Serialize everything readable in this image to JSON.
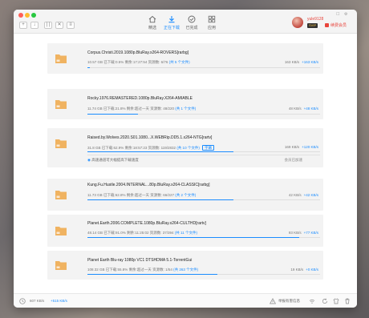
{
  "toolbar": {
    "buttons": [
      "+",
      "↓",
      "| |",
      "✕",
      "≡"
    ]
  },
  "tabs": [
    {
      "label": "精选",
      "icon": "home-icon"
    },
    {
      "label": "正在下载",
      "icon": "download-icon"
    },
    {
      "label": "已完成",
      "icon": "check-circle-icon"
    },
    {
      "label": "应用",
      "icon": "apps-icon"
    }
  ],
  "account": {
    "username": "yule9128",
    "vip_badge": "SVIP",
    "upgrade_label": "续费会员"
  },
  "downloads": [
    {
      "name": "Corpus.Christi.2019.1080p.BluRay.x264-ROVERS[rarbg]",
      "size": "10.57 GB",
      "downloaded": "已下载:0.5%",
      "remaining": "剩余:17:27:54",
      "resources": "资源数: 6/76",
      "files": "(共 5 个文件)",
      "down_speed": "163 KB/s",
      "up_speed": "+163 KB/s",
      "progress": 0.005
    },
    {
      "name": "Rocky.1976.REMASTERED.1080p.BluRay.X264-AMIABLE",
      "size": "11.74 GB",
      "downloaded": "已下载:21.8%",
      "remaining": "剩余:超过一天",
      "resources": "资源数: 48/220",
      "files": "(共 1 个文件)",
      "down_speed": "48 KB/s",
      "up_speed": "+48 KB/s",
      "progress": 0.218
    },
    {
      "name": "Raised.by.Wolves.2020.S01.1080...X.WEBRip.DD5.1.x264-NTG[rartv]",
      "size": "31.8 GB",
      "downloaded": "已下载:62.9%",
      "remaining": "剩余:18:57:23",
      "resources": "资源数: 119/2832",
      "files": "(共 10 个文件)",
      "tag": "字幕",
      "down_speed": "169 KB/s",
      "up_speed": "+120 KB/s",
      "progress": 0.629,
      "hint": "高速通道可大幅提高下载速度",
      "hint_right": "会员已加速"
    },
    {
      "name": "Kung.Fu.Hustle.2004.INTERNAL...80p.BluRay.x264-CLASSIC[rarbg]",
      "size": "11.73 GB",
      "downloaded": "已下载:62.8%",
      "remaining": "剩余:超过一天",
      "resources": "资源数: 66/227",
      "files": "(共 2 个文件)",
      "down_speed": "42 KB/s",
      "up_speed": "+42 KB/s",
      "progress": 0.628
    },
    {
      "name": "Planet.Earth.2006.COMPLETE.1080p.BluRay.x264-CULTHD[rartv]",
      "size": "48.14 GB",
      "downloaded": "已下载:91.0%",
      "remaining": "剩余:11:25:02",
      "resources": "资源数: 37/394",
      "files": "(共 11 个文件)",
      "down_speed": "93 KB/s",
      "up_speed": "+77 KB/s",
      "progress": 0.91
    },
    {
      "name": "Planet Earth Blu-ray 1080p VC1 DTSHDMA 5.1-TorrentGui",
      "size": "108.32 GB",
      "downloaded": "已下载:55.8%",
      "remaining": "剩余:超过一天",
      "resources": "资源数: 1/54",
      "files": "(共 263 个文件)",
      "down_speed": "19 KB/s",
      "up_speed": "+0 KB/s",
      "progress": 0.558
    }
  ],
  "statusbar": {
    "total_down": "607 KB/s",
    "total_up": "+515 KB/s",
    "report_label": "举报有害信息"
  },
  "colors": {
    "accent": "#1a8cff",
    "folder": "#f0b361",
    "vip": "#e8453c"
  }
}
